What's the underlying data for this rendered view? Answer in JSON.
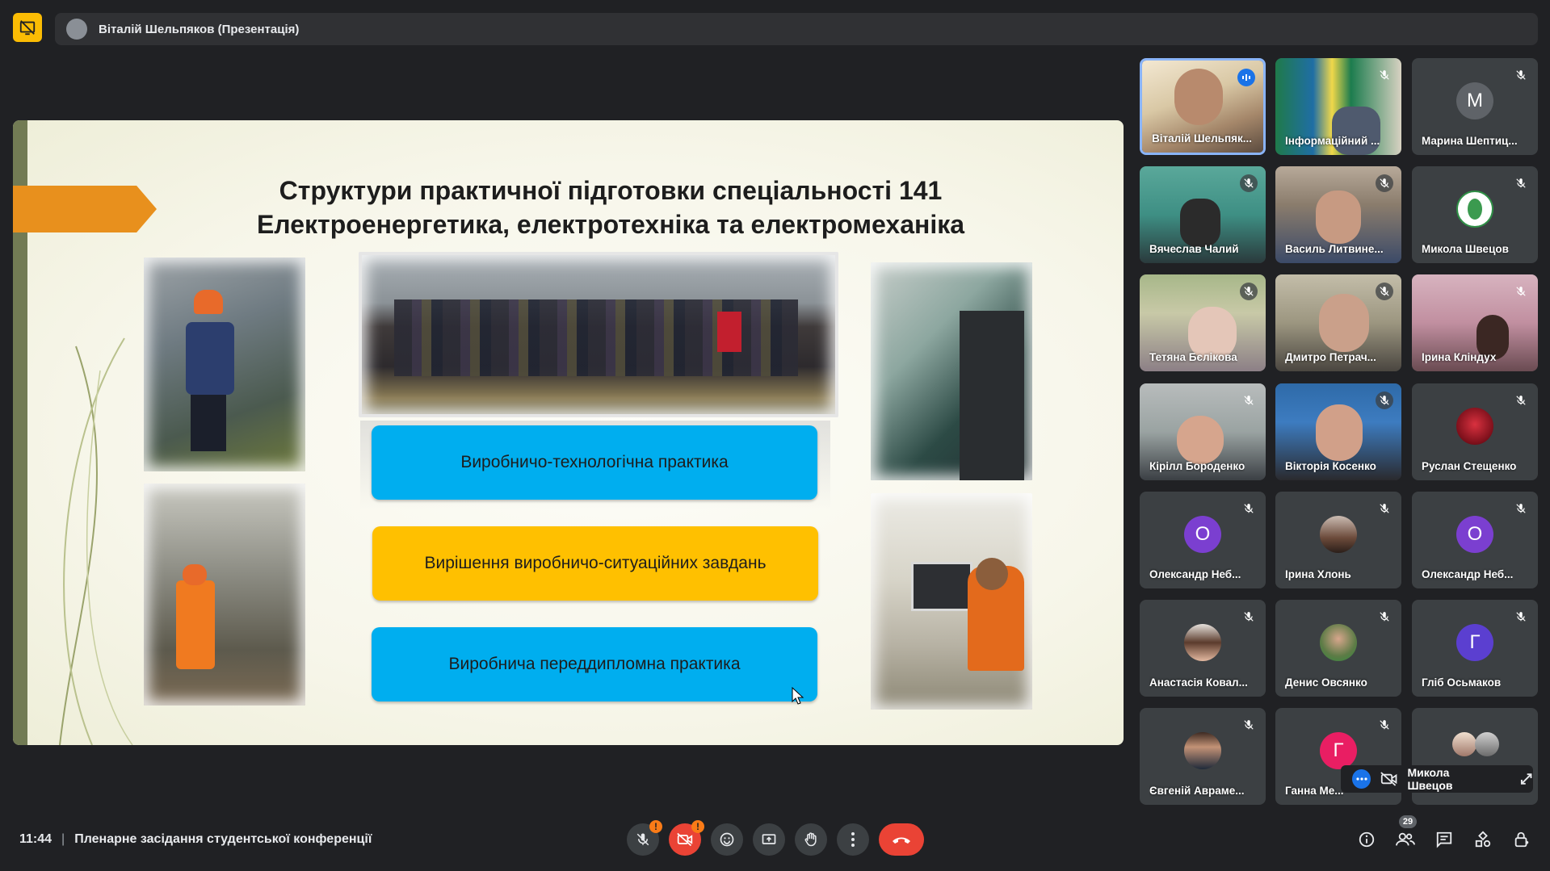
{
  "topbar": {
    "presenter_title": "Віталій Шельпяков (Презентація)",
    "stop_presenting_icon": "present-off-icon"
  },
  "slide": {
    "title_line1": "Структури практичної підготовки спеціальності 141",
    "title_line2": "Електроенергетика, електротехніка та електромеханіка",
    "boxes": [
      {
        "label": "Виробничо-технологічна практика",
        "color": "#00aeef"
      },
      {
        "label": "Вирішення виробничо-ситуаційних завдань",
        "color": "#ffc000"
      },
      {
        "label": "Виробнича переддипломна практика",
        "color": "#00aeef"
      }
    ],
    "accent_color": "#e8901d"
  },
  "participants": [
    {
      "name": "Віталій Шельпяк..."
    },
    {
      "name": "Інформаційний ..."
    },
    {
      "name": "Марина Шептиц...",
      "initial": "М"
    },
    {
      "name": "Вячеслав Чалий"
    },
    {
      "name": "Василь Литвине..."
    },
    {
      "name": "Микола Швецов"
    },
    {
      "name": "Тетяна Бєлікова"
    },
    {
      "name": "Дмитро Петрач..."
    },
    {
      "name": "Ірина Кліндух"
    },
    {
      "name": "Кірілл Бороденко"
    },
    {
      "name": "Вікторія Косенко"
    },
    {
      "name": "Руслан Стещенко"
    },
    {
      "name": "Олександр Неб...",
      "initial": "О"
    },
    {
      "name": "Ірина Хлонь"
    },
    {
      "name": "Олександр Неб...",
      "initial": "О"
    },
    {
      "name": "Анастасія Ковал..."
    },
    {
      "name": "Денис Овсянко"
    },
    {
      "name": "Гліб Осьмаков",
      "initial": "Г"
    },
    {
      "name": "Євгеній Аврамe..."
    },
    {
      "name": "Ганна Ме...",
      "initial": "Г"
    }
  ],
  "self_view": {
    "name": "Микола Швецов"
  },
  "bottom": {
    "time": "11:44",
    "separator": "|",
    "meeting_title": "Пленарне засідання студентської конференції",
    "participants_count": "29"
  }
}
